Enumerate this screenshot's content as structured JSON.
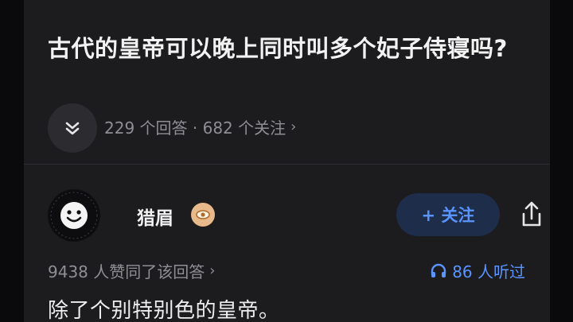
{
  "question": {
    "title": "古代的皇帝可以晚上同时叫多个妃子侍寝吗?",
    "meta": "229 个回答 · 682 个关注",
    "meta_chevron": "›",
    "collapse_icon": "double-chevron-down-icon"
  },
  "answer": {
    "author_name": "猎眉",
    "avatar_icon": "smiley-avatar",
    "badge_icon": "eye-badge-icon",
    "follow_label": "+ 关注",
    "share_icon": "share-icon",
    "agree_text": "9438 人赞同了该回答",
    "agree_chevron": "›",
    "listen_text": "86 人听过",
    "listen_icon": "headphones-icon",
    "first_line": "除了个别特别色的皇帝。"
  },
  "colors": {
    "background": "#1c1c1f",
    "accent": "#5a94ff",
    "follow_bg": "#1d2d4a",
    "badge": "#e7b98b"
  }
}
